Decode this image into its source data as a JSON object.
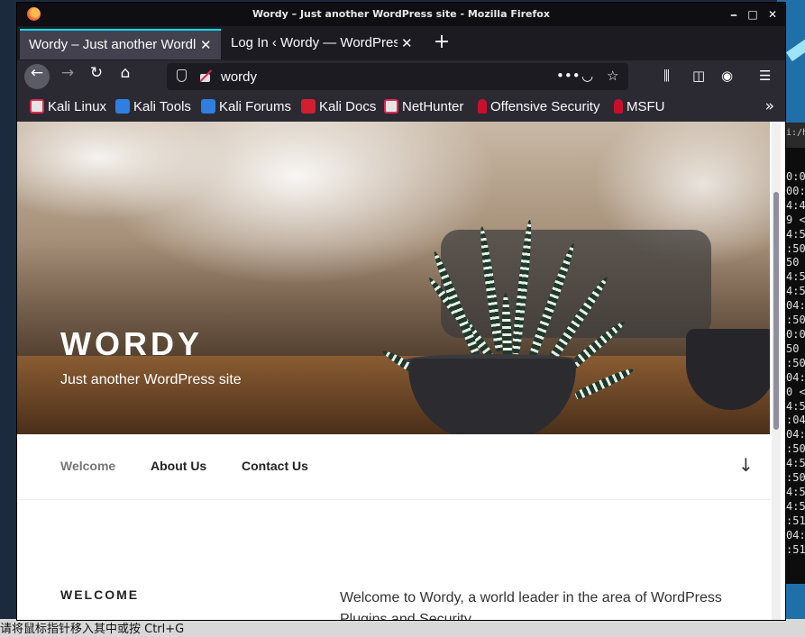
{
  "window": {
    "title": "Wordy – Just another WordPress site - Mozilla Firefox"
  },
  "tabs": [
    {
      "label": "Wordy – Just another Wordl"
    },
    {
      "label": "Log In ‹ Wordy — WordPres"
    }
  ],
  "urlbar": {
    "value": "wordy"
  },
  "bookmarks": [
    {
      "label": "Kali Linux",
      "icon": "kali-icon"
    },
    {
      "label": "Kali Tools",
      "icon": "kali-tools-icon"
    },
    {
      "label": "Kali Forums",
      "icon": "kali-forums-icon"
    },
    {
      "label": "Kali Docs",
      "icon": "kali-docs-icon"
    },
    {
      "label": "NetHunter",
      "icon": "nethunter-icon"
    },
    {
      "label": "Offensive Security",
      "icon": "offsec-icon"
    },
    {
      "label": "MSFU",
      "icon": "msfu-icon"
    }
  ],
  "site": {
    "title": "WORDY",
    "description": "Just another WordPress site",
    "nav": [
      "Welcome",
      "About Us",
      "Contact Us"
    ],
    "section_heading": "WELCOME",
    "intro": "Welcome to Wordy, a world leader in the area of WordPress Plugins and Security."
  },
  "terminal": {
    "title": "i:/h",
    "lines": [
      "0:0",
      "00:",
      "4:4",
      "9 <",
      "4:5",
      ":50",
      "50 ",
      "4:5",
      "4:5",
      "04:",
      ":50",
      "0:0",
      "50 ",
      ":50",
      "04:",
      "0 <",
      "4:5",
      ":04",
      "04:",
      ":50",
      "4:5",
      ":50",
      "4:5",
      "4:5",
      ":51",
      "04:",
      ":51"
    ]
  },
  "taskbar_hint": "请将鼠标指针移入其中或按 Ctrl+G",
  "colors": {
    "accent": "#00ddff",
    "toolbar": "#2b2a33",
    "tab_active": "#42414d"
  }
}
